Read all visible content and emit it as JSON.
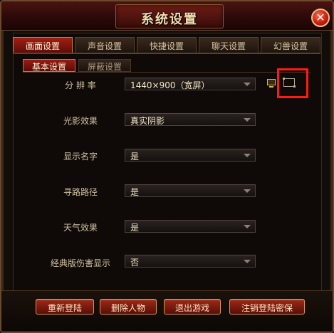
{
  "window": {
    "title": "系统设置"
  },
  "tabs": [
    "画面设置",
    "声音设置",
    "快捷设置",
    "聊天设置",
    "幻兽设置"
  ],
  "subtabs": [
    "基本设置",
    "屏蔽设置"
  ],
  "settings": [
    {
      "label": "分 辨 率",
      "value": "1440×900（宽屏）"
    },
    {
      "label": "光影效果",
      "value": "真实阴影"
    },
    {
      "label": "显示名字",
      "value": "是"
    },
    {
      "label": "寻路路径",
      "value": "是"
    },
    {
      "label": "天气效果",
      "value": "是"
    },
    {
      "label": "经典版伤害显示",
      "value": "否"
    }
  ],
  "icons": {
    "windowed": "monitor-icon",
    "fullscreen": "fullscreen-icon",
    "close": "close-icon"
  },
  "buttons": [
    "重新登陆",
    "删除人物",
    "退出游戏",
    "注销登陆密保"
  ],
  "colors": {
    "accent": "#a21e13",
    "highlight": "#ff1a12",
    "gold": "#d29a52"
  }
}
